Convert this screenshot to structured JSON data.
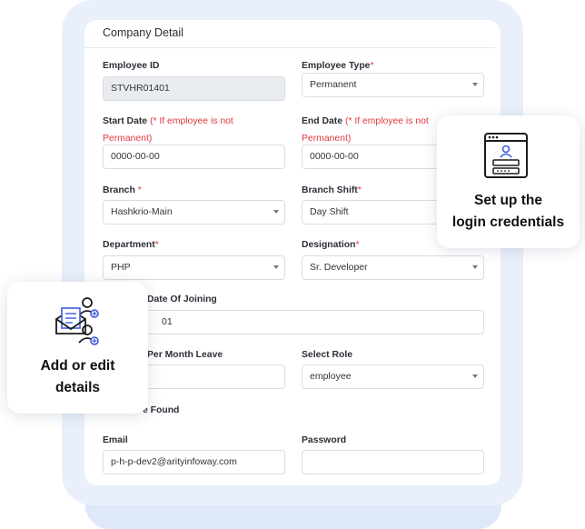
{
  "card": {
    "title": "Company Detail",
    "fields": {
      "employee_id": {
        "label": "Employee ID",
        "value": "STVHR01401"
      },
      "employee_type": {
        "label": "Employee Type",
        "req": "*",
        "value": "Permanent"
      },
      "start_date": {
        "label": "Start Date",
        "note1": "(* If employee is not",
        "note2": "Permanent)",
        "value": "0000-00-00"
      },
      "end_date": {
        "label": "End Date",
        "note1": "(* If employee is not",
        "note2": "Permanent)",
        "value": "0000-00-00"
      },
      "branch": {
        "label": "Branch",
        "req": "*",
        "value": "Hashkrio-Main"
      },
      "branch_shift": {
        "label": "Branch Shift",
        "req": "*",
        "value": "Day Shift"
      },
      "department": {
        "label": "Department",
        "req": "*",
        "value": "PHP"
      },
      "designation": {
        "label": "Designation",
        "req": "*",
        "value": "Sr. Developer"
      },
      "date_of_joining": {
        "label": "Date Of Joining",
        "value": "01"
      },
      "per_month_leave": {
        "label": "Per Month Leave",
        "value": ""
      },
      "select_role": {
        "label": "Select Role",
        "value": "employee"
      },
      "found_text": "e Found",
      "email": {
        "label": "Email",
        "value": "p-h-p-dev2@arityinfoway.com"
      },
      "password": {
        "label": "Password",
        "value": ""
      }
    }
  },
  "callouts": {
    "login": {
      "line1": "Set up the",
      "line2": "login credentials",
      "icon": "login-window-icon"
    },
    "details": {
      "line1": "Add or edit",
      "line2": "details",
      "icon": "edit-details-icon"
    }
  },
  "colors": {
    "required": "#e0383e",
    "frame": "#eaf0fb"
  }
}
